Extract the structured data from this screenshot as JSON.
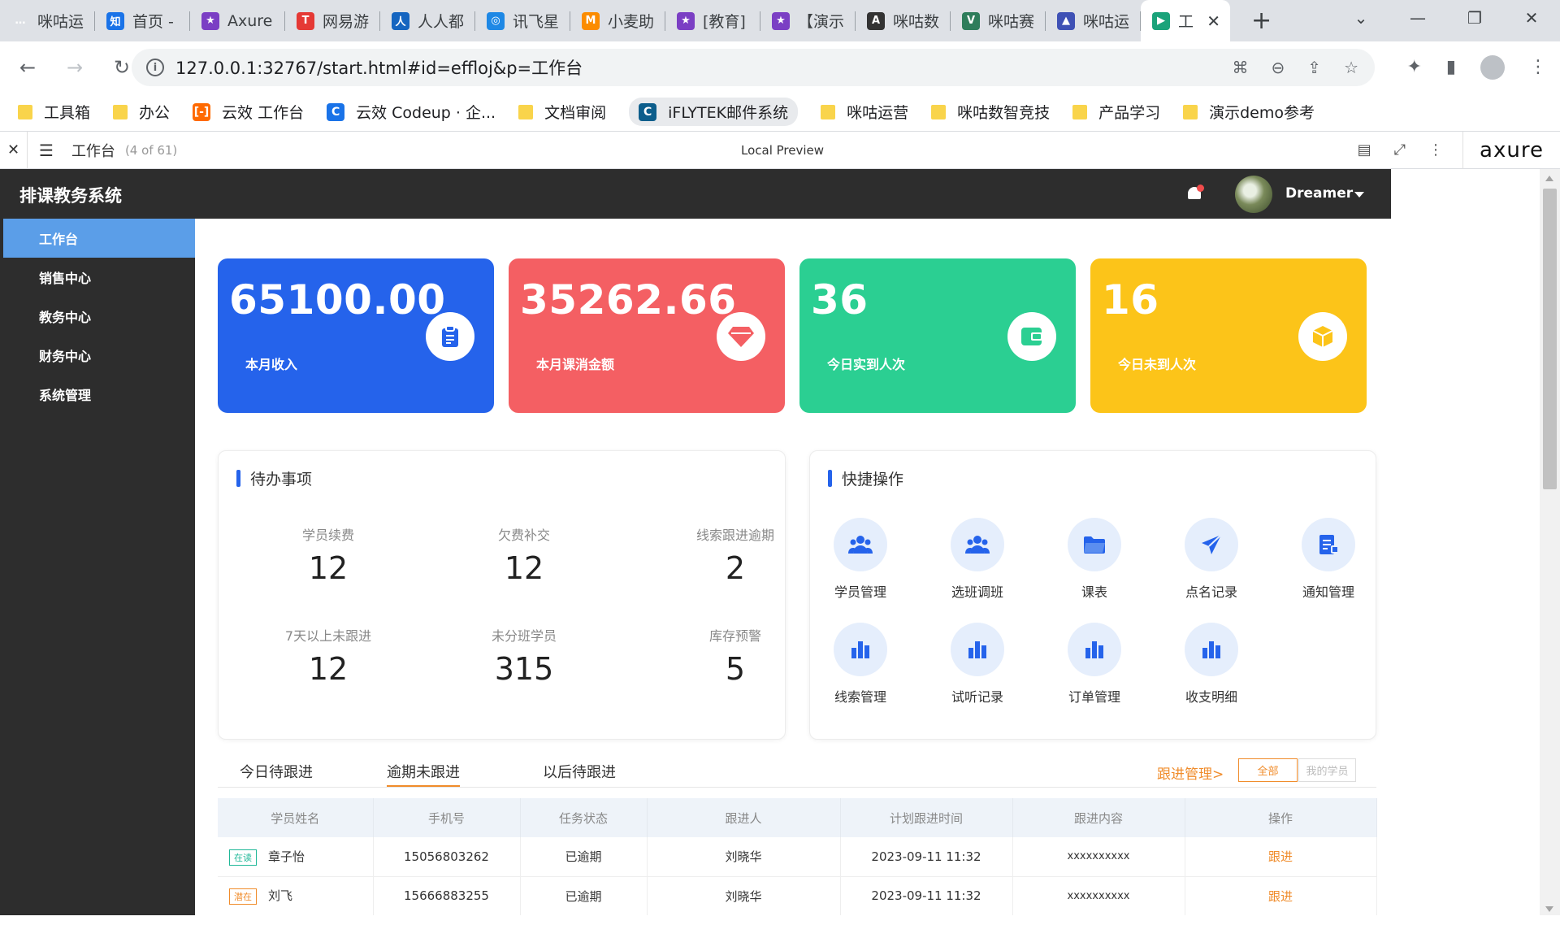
{
  "browser": {
    "tabs": [
      {
        "title": "咪咕运",
        "color": "#dee1e6",
        "glyph": "…"
      },
      {
        "title": "首页 -",
        "color": "#1a73e8",
        "glyph": "知"
      },
      {
        "title": "Axure",
        "color": "#7b3fc4",
        "glyph": "★"
      },
      {
        "title": "网易游",
        "color": "#e53935",
        "glyph": "T"
      },
      {
        "title": "人人都",
        "color": "#1565c0",
        "glyph": "人"
      },
      {
        "title": "讯飞星",
        "color": "#1e88e5",
        "glyph": "◎"
      },
      {
        "title": "小麦助",
        "color": "#fb8c00",
        "glyph": "M"
      },
      {
        "title": "[教育]",
        "color": "#7b3fc4",
        "glyph": "★"
      },
      {
        "title": "【演示",
        "color": "#7b3fc4",
        "glyph": "★"
      },
      {
        "title": "咪咕数",
        "color": "#333333",
        "glyph": "A"
      },
      {
        "title": "咪咕赛",
        "color": "#2e7d5b",
        "glyph": "V"
      },
      {
        "title": "咪咕运",
        "color": "#3f51b5",
        "glyph": "▲"
      },
      {
        "title": "工",
        "color": "#1aa37a",
        "glyph": "▶"
      }
    ],
    "new_tab": "+",
    "url": "127.0.0.1:32767/start.html#id=effloj&p=工作台",
    "bookmarks": [
      {
        "label": "工具箱",
        "type": "folder"
      },
      {
        "label": "办公",
        "type": "folder"
      },
      {
        "label": "云效 工作台",
        "type": "icon",
        "color": "#ff6a00",
        "glyph": "[-]"
      },
      {
        "label": "云效 Codeup · 企...",
        "type": "icon",
        "color": "#1a73e8",
        "glyph": "C"
      },
      {
        "label": "文档审阅",
        "type": "folder"
      },
      {
        "label": "iFLYTEK邮件系统",
        "type": "chip",
        "color": "#0d5e8c",
        "glyph": "C"
      },
      {
        "label": "咪咕运营",
        "type": "folder"
      },
      {
        "label": "咪咕数智竞技",
        "type": "folder"
      },
      {
        "label": "产品学习",
        "type": "folder"
      },
      {
        "label": "演示demo参考",
        "type": "folder"
      }
    ]
  },
  "axure": {
    "page_name": "工作台",
    "page_count": "(4 of 61)",
    "preview_label": "Local Preview",
    "logo": "axure"
  },
  "app": {
    "title": "排课教务系统",
    "user_name": "Dreamer",
    "sidebar": [
      {
        "label": "工作台",
        "active": true
      },
      {
        "label": "销售中心",
        "active": false
      },
      {
        "label": "教务中心",
        "active": false
      },
      {
        "label": "财务中心",
        "active": false
      },
      {
        "label": "系统管理",
        "active": false
      }
    ],
    "stats": [
      {
        "value": "65100.00",
        "label": "本月收入",
        "color": "#2563eb",
        "icon": "clipboard-icon"
      },
      {
        "value": "35262.66",
        "label": "本月课消金额",
        "color": "#f45f63",
        "icon": "diamond-icon"
      },
      {
        "value": "36",
        "label": "今日实到人次",
        "color": "#2bcf92",
        "icon": "wallet-icon"
      },
      {
        "value": "16",
        "label": "今日未到人次",
        "color": "#fcc419",
        "icon": "box-icon"
      }
    ],
    "todo": {
      "title": "待办事项",
      "items": [
        {
          "label": "学员续费",
          "value": "12"
        },
        {
          "label": "欠费补交",
          "value": "12"
        },
        {
          "label": "线索跟进逾期",
          "value": "2"
        },
        {
          "label": "7天以上未跟进",
          "value": "12"
        },
        {
          "label": "未分班学员",
          "value": "315"
        },
        {
          "label": "库存预警",
          "value": "5"
        }
      ]
    },
    "quick": {
      "title": "快捷操作",
      "items": [
        {
          "label": "学员管理",
          "icon": "users-icon"
        },
        {
          "label": "选班调班",
          "icon": "users-icon"
        },
        {
          "label": "课表",
          "icon": "folder-icon"
        },
        {
          "label": "点名记录",
          "icon": "send-icon"
        },
        {
          "label": "通知管理",
          "icon": "document-icon"
        },
        {
          "label": "线索管理",
          "icon": "bar-chart-icon"
        },
        {
          "label": "试听记录",
          "icon": "bar-chart-icon"
        },
        {
          "label": "订单管理",
          "icon": "bar-chart-icon"
        },
        {
          "label": "收支明细",
          "icon": "bar-chart-icon"
        }
      ]
    },
    "follow": {
      "tabs": [
        "今日待跟进",
        "逾期未跟进",
        "以后待跟进"
      ],
      "active_tab": 1,
      "manage_link": "跟进管理>",
      "filter_all": "全部",
      "filter_mine": "我的学员",
      "columns": [
        "学员姓名",
        "手机号",
        "任务状态",
        "跟进人",
        "计划跟进时间",
        "跟进内容",
        "操作"
      ],
      "rows": [
        {
          "tag": "在读",
          "tag_color": "green",
          "name": "章子怡",
          "phone": "15056803262",
          "status": "已逾期",
          "follower": "刘晓华",
          "time": "2023-09-11 11:32",
          "content": "xxxxxxxxxx",
          "action": "跟进"
        },
        {
          "tag": "潜在",
          "tag_color": "orange",
          "name": "刘飞",
          "phone": "15666883255",
          "status": "已逾期",
          "follower": "刘晓华",
          "time": "2023-09-11 11:32",
          "content": "xxxxxxxxxx",
          "action": "跟进"
        }
      ]
    }
  }
}
